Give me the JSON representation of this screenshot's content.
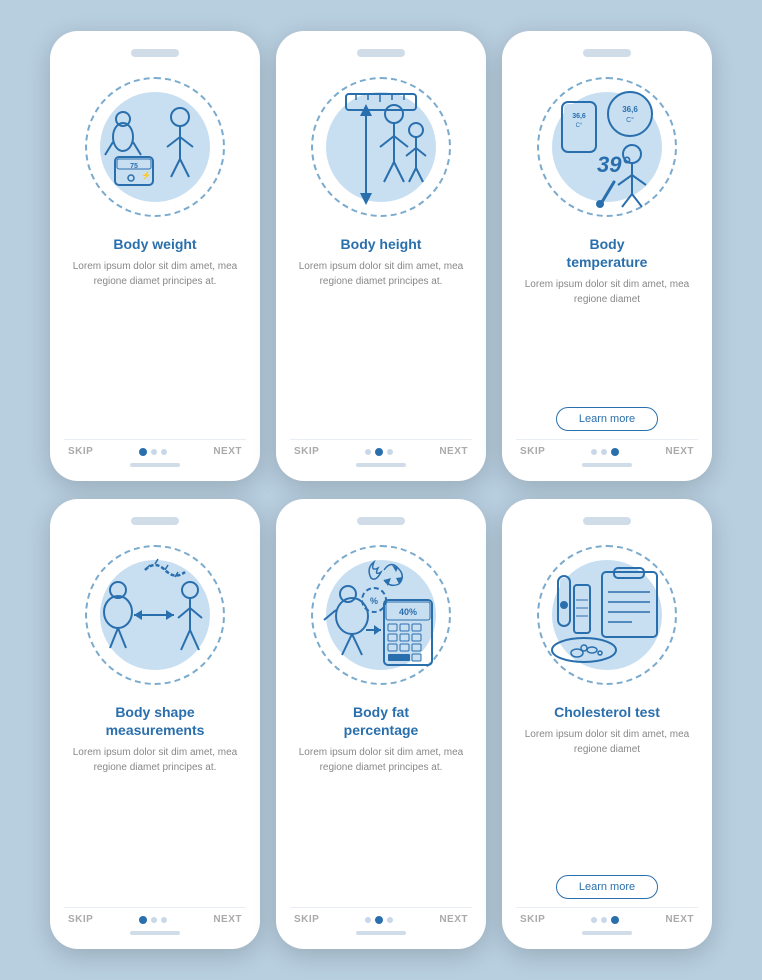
{
  "cards": [
    {
      "id": "body-weight",
      "title": "Body weight",
      "body": "Lorem ipsum dolor sit dim amet, mea regione diamet principes at.",
      "has_learn_more": false,
      "active_dot": 0,
      "dots": 3,
      "skip": "SKIP",
      "next": "NEXT"
    },
    {
      "id": "body-height",
      "title": "Body height",
      "body": "Lorem ipsum dolor sit dim amet, mea regione diamet principes at.",
      "has_learn_more": false,
      "active_dot": 1,
      "dots": 3,
      "skip": "SKIP",
      "next": "NEXT"
    },
    {
      "id": "body-temperature",
      "title": "Body\ntemperature",
      "body": "Lorem ipsum dolor sit dim amet, mea regione diamet",
      "has_learn_more": true,
      "learn_more_label": "Learn more",
      "active_dot": 2,
      "dots": 3,
      "skip": "SKIP",
      "next": "NEXT"
    },
    {
      "id": "body-shape",
      "title": "Body shape\nmeasurements",
      "body": "Lorem ipsum dolor sit dim amet, mea regione diamet principes at.",
      "has_learn_more": false,
      "active_dot": 0,
      "dots": 3,
      "skip": "SKIP",
      "next": "NEXT"
    },
    {
      "id": "body-fat",
      "title": "Body fat\npercentage",
      "body": "Lorem ipsum dolor sit dim amet, mea regione diamet principes at.",
      "has_learn_more": false,
      "active_dot": 1,
      "dots": 3,
      "skip": "SKIP",
      "next": "NEXT"
    },
    {
      "id": "cholesterol-test",
      "title": "Cholesterol test",
      "body": "Lorem ipsum dolor sit dim amet, mea regione diamet",
      "has_learn_more": true,
      "learn_more_label": "Learn more",
      "active_dot": 2,
      "dots": 3,
      "skip": "SKIP",
      "next": "NEXT"
    }
  ]
}
